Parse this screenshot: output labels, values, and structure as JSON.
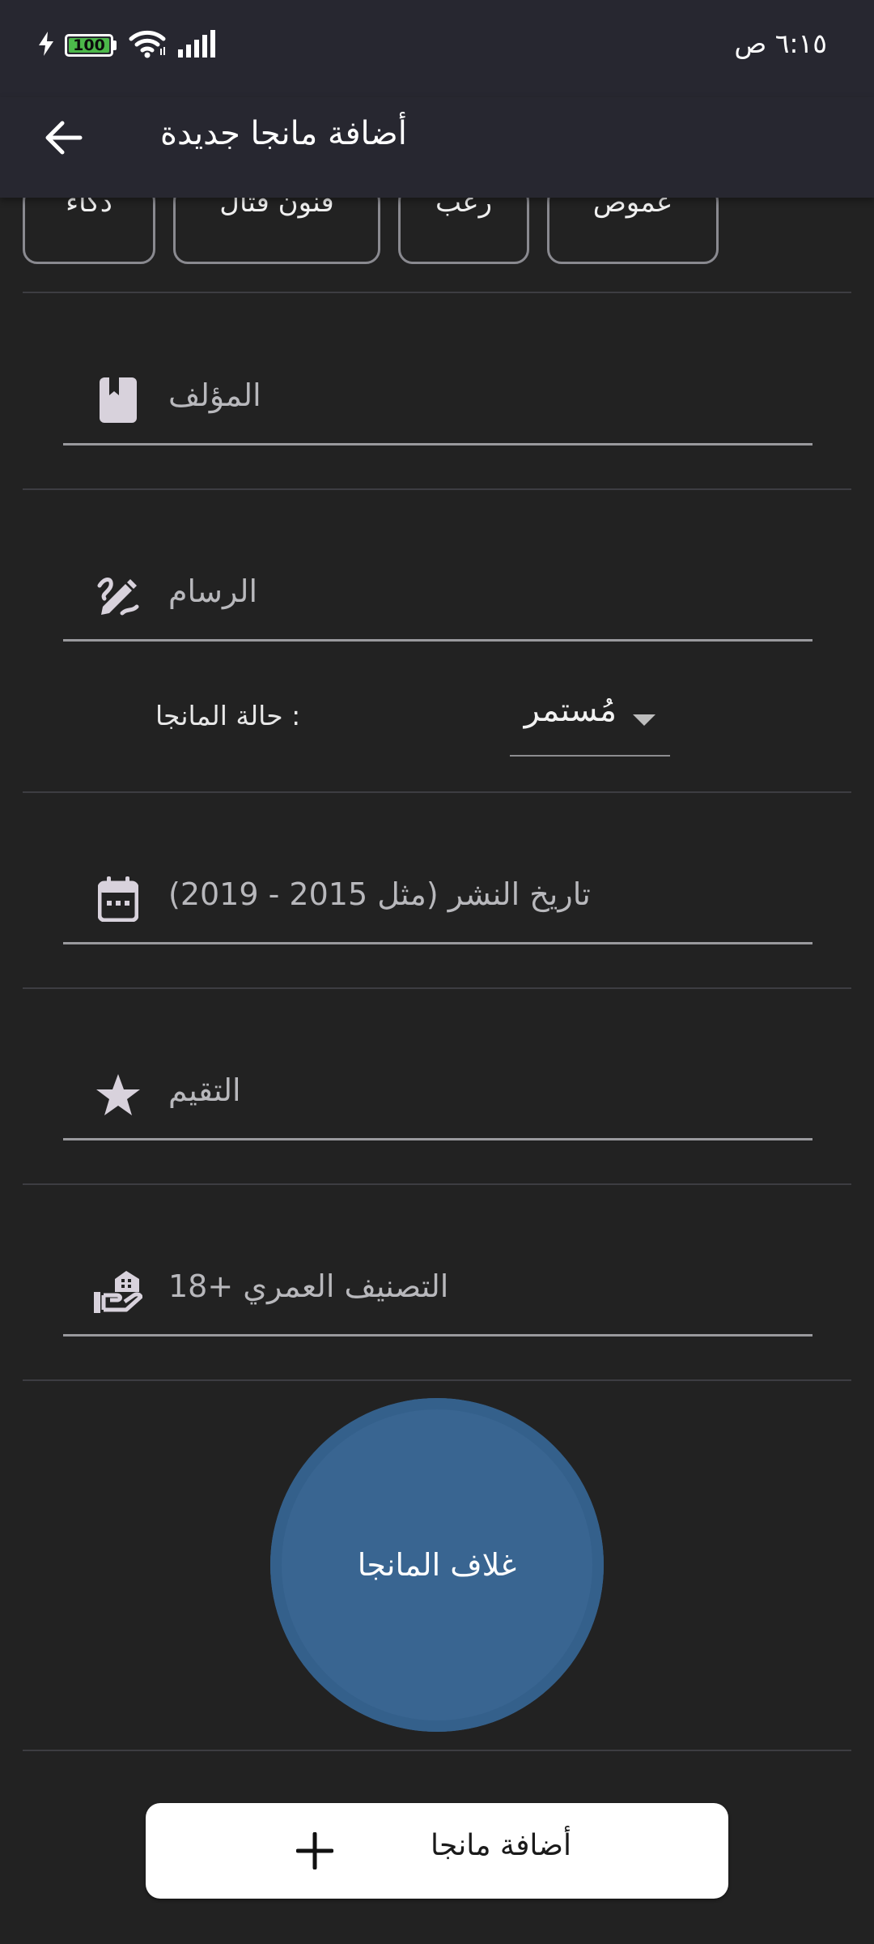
{
  "status_bar": {
    "time": "٦:١٥ ص",
    "battery_level": "100",
    "icons": [
      "charging-icon",
      "battery-icon",
      "wifi-icon",
      "signal-icon"
    ]
  },
  "app_bar": {
    "title": "أضافة مانجا جديدة",
    "back_icon": "arrow-back-icon"
  },
  "genre_chips": [
    "عموص",
    "رعب",
    "فنون قتال",
    "ذكاء"
  ],
  "fields": {
    "author": {
      "placeholder": "المؤلف",
      "icon": "book-icon"
    },
    "artist": {
      "placeholder": "الرسام",
      "icon": "draw-icon"
    },
    "release_date": {
      "placeholder": "تاريخ النشر (مثل  2015 - 2019)",
      "icon": "calendar-icon"
    },
    "rating": {
      "placeholder": "التقيم",
      "icon": "star-icon"
    },
    "age_rating": {
      "placeholder": "التصنيف العمري +18",
      "icon": "hand-house-icon"
    }
  },
  "status": {
    "label": ": حالة المانجا",
    "selected": "مُستمر"
  },
  "cover": {
    "label": "غلاف المانجا"
  },
  "add_button": {
    "label": "أضافة مانجا",
    "icon": "plus-icon"
  },
  "colors": {
    "background": "#222222",
    "app_bar": "#272730",
    "cover_circle": "#396591",
    "button": "#ffffff",
    "icon": "#d8d2dc"
  }
}
